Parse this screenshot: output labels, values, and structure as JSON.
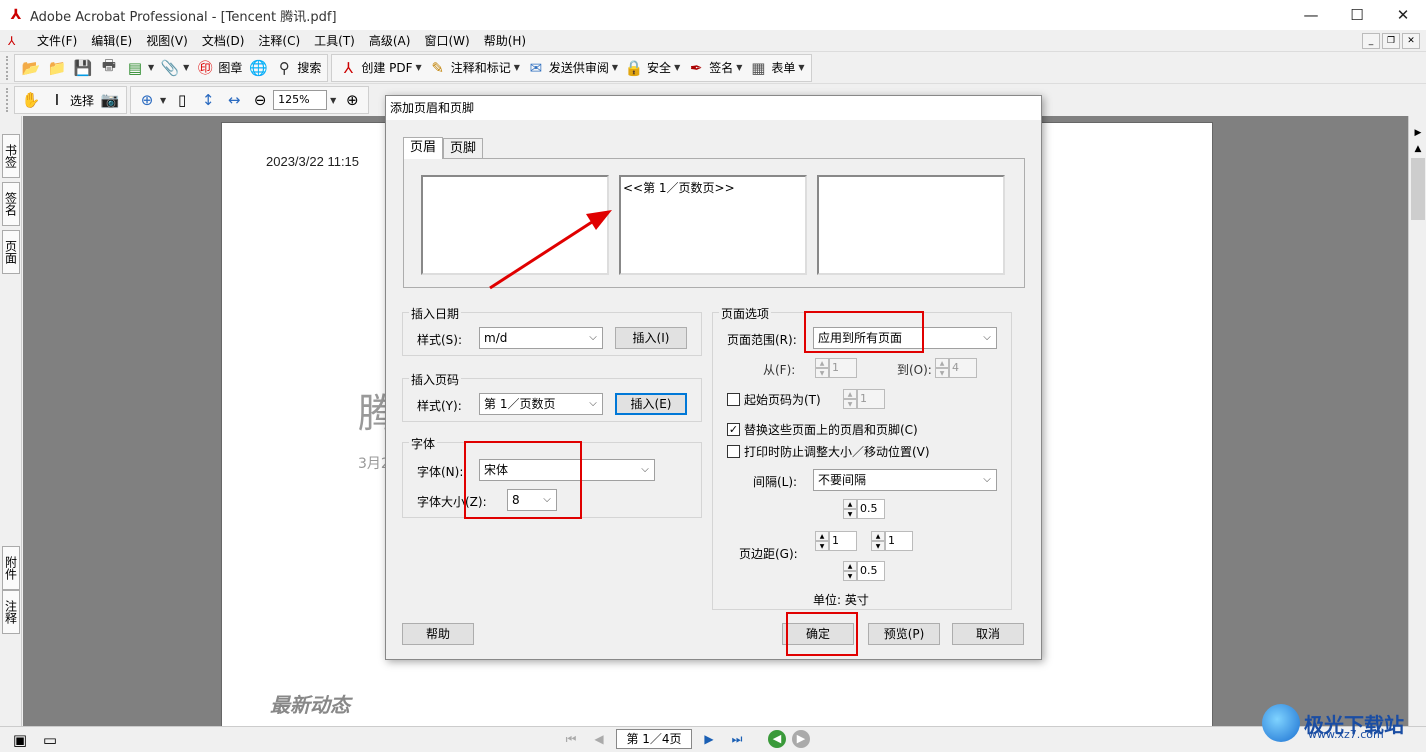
{
  "window": {
    "title": "Adobe Acrobat Professional - [Tencent 腾讯.pdf]"
  },
  "menu": [
    "文件(F)",
    "编辑(E)",
    "视图(V)",
    "文档(D)",
    "注释(C)",
    "工具(T)",
    "高级(A)",
    "窗口(W)",
    "帮助(H)"
  ],
  "toolbar1": {
    "stamp": "图章",
    "search": "搜索",
    "create_pdf": "创建 PDF",
    "comment_markup": "注释和标记",
    "send_review": "发送供审阅",
    "security": "安全",
    "sign": "签名",
    "forms": "表单"
  },
  "toolbar2": {
    "select": "选择",
    "zoom": "125%"
  },
  "side_tabs": {
    "bookmarks": "书签",
    "signatures": "签名",
    "pages": "页面",
    "attachments": "附件",
    "comments": "注释"
  },
  "document": {
    "date": "2023/3/22 11:15",
    "big_text": "腾",
    "small_text": "3月2",
    "news": "最新动态"
  },
  "dialog": {
    "title": "添加页眉和页脚",
    "tabs": {
      "header": "页眉",
      "footer": "页脚"
    },
    "center_box": "<<第 1／页数页>>",
    "insert_date": {
      "group": "插入日期",
      "style_label": "样式(S):",
      "style_value": "m/d",
      "insert_btn": "插入(I)"
    },
    "insert_page": {
      "group": "插入页码",
      "style_label": "样式(Y):",
      "style_value": "第 1／页数页",
      "insert_btn": "插入(E)"
    },
    "font": {
      "group": "字体",
      "name_label": "字体(N):",
      "name_value": "宋体",
      "size_label": "字体大小(Z):",
      "size_value": "8"
    },
    "page_options": {
      "group": "页面选项",
      "range_label": "页面范围(R):",
      "range_value": "应用到所有页面",
      "from_label": "从(F):",
      "from_value": "1",
      "to_label": "到(O):",
      "to_value": "4",
      "start_page_label": "起始页码为(T)",
      "start_page_value": "1",
      "replace_label": "替换这些页面上的页眉和页脚(C)",
      "prevent_label": "打印时防止调整大小／移动位置(V)",
      "spacing_label": "间隔(L):",
      "spacing_value": "不要间隔",
      "spacing_num": "0.5",
      "margin_label": "页边距(G):",
      "margin_left": "1",
      "margin_right": "1",
      "margin_bottom": "0.5",
      "unit_label": "单位: 英寸"
    },
    "buttons": {
      "help": "帮助",
      "ok": "确定",
      "preview": "预览(P)",
      "cancel": "取消"
    }
  },
  "statusbar": {
    "page_field": "第 1／4页"
  },
  "watermark": {
    "text": "极光下载站",
    "url": "www.xz7.com"
  },
  "colors": {
    "annotation_red": "#e00000",
    "focus_blue": "#0078d7"
  }
}
